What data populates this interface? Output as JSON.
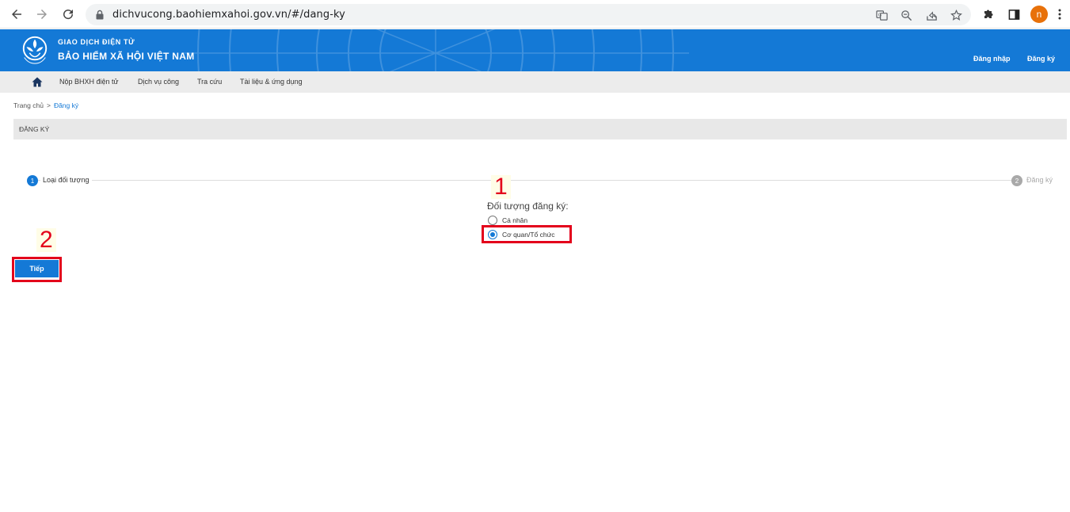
{
  "browser": {
    "url": "dichvucong.baohiemxahoi.gov.vn/#/dang-ky",
    "profile_initial": "n"
  },
  "header": {
    "brand_sub": "GIAO DỊCH ĐIỆN TỬ",
    "brand_main": "BẢO HIỂM XÃ HỘI VIỆT NAM",
    "login_label": "Đăng nhập",
    "register_label": "Đăng ký",
    "background_color": "#1479d6"
  },
  "menu": {
    "items": [
      {
        "label": "Nộp BHXH điện tử"
      },
      {
        "label": "Dịch vụ công"
      },
      {
        "label": "Tra cứu"
      },
      {
        "label": "Tài liệu & ứng dụng"
      }
    ]
  },
  "breadcrumb": {
    "home": "Trang chủ",
    "separator": ">",
    "current": "Đăng ký"
  },
  "section_title": "ĐĂNG KÝ",
  "stepper": {
    "steps": [
      {
        "number": "1",
        "label": "Loại đối tượng",
        "active": true
      },
      {
        "number": "2",
        "label": "Đăng ký",
        "active": false
      }
    ]
  },
  "form": {
    "label": "Đối tượng đăng ký:",
    "options": [
      {
        "label": "Cá nhân",
        "checked": false
      },
      {
        "label": "Cơ quan/Tổ chức",
        "checked": true
      }
    ]
  },
  "buttons": {
    "next_label": "Tiếp"
  },
  "annotations": {
    "one": "1",
    "two": "2",
    "color": "#e3001b"
  }
}
